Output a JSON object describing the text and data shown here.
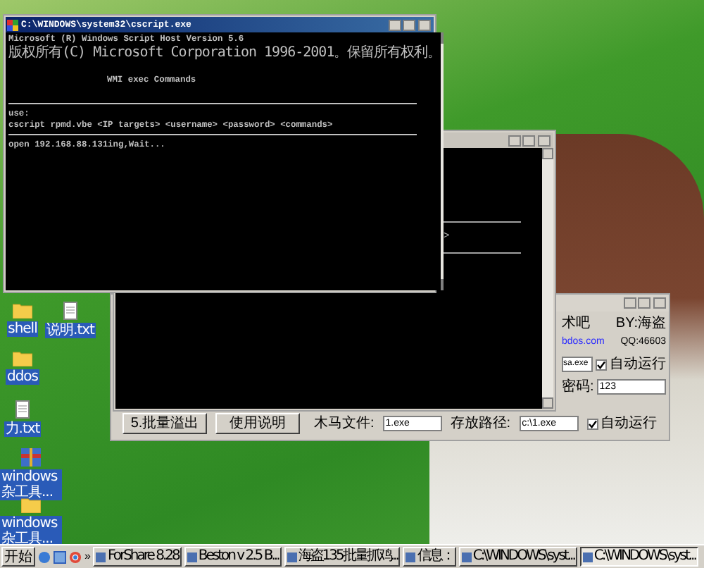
{
  "console_window": {
    "title": "C:\\WINDOWS\\system32\\cscript.exe",
    "lines": [
      {
        "kind": "text",
        "text": "Microsoft (R) Windows Script Host Version 5.6"
      },
      {
        "kind": "cjk",
        "text": "版权所有(C) Microsoft Corporation 1996-2001。保留所有权利。"
      },
      {
        "kind": "blank"
      },
      {
        "kind": "heading",
        "text": "WMI exec Commands"
      },
      {
        "kind": "blank"
      },
      {
        "kind": "rule"
      },
      {
        "kind": "text",
        "text": "use:"
      },
      {
        "kind": "text",
        "text": "cscript rpmd.vbe <IP targets> <username> <password> <commands>"
      },
      {
        "kind": "rule"
      },
      {
        "kind": "text",
        "text": "open 192.168.88.131ing,Wait..."
      }
    ]
  },
  "back_console": {
    "text": ">"
  },
  "tool_window": {
    "author": "术吧",
    "by": "BY:海盗",
    "site": "bdos.com",
    "qq": "QQ:46603",
    "exe_field": "sa.exe",
    "exe_autorun": {
      "label": "自动运行",
      "checked": true
    },
    "password_label": "密码:",
    "password": "123",
    "buttons": [
      "5.批量溢出",
      "使用说明"
    ],
    "trojan_label": "木马文件:",
    "trojan_file": "1.exe",
    "path_label": "存放路径:",
    "path": "c:\\1.exe",
    "autorun": {
      "label": "自动运行",
      "checked": true
    }
  },
  "desktop_icons": [
    {
      "label": "shell",
      "kind": "folder"
    },
    {
      "label": "说明.txt",
      "kind": "text"
    },
    {
      "label": "ddos",
      "kind": "folder"
    },
    {
      "label": "力.txt",
      "kind": "text"
    },
    {
      "label": "windows 杂工具...",
      "kind": "archive"
    },
    {
      "label": "windows 杂工具...",
      "kind": "folder"
    }
  ],
  "taskbar": {
    "start": "开始",
    "chevron": "»",
    "buttons": [
      {
        "label": "ForShare 8.28",
        "selected": false
      },
      {
        "label": "Beston v 2.5  B...",
        "selected": false
      },
      {
        "label": "海盗135批量抓鸡...",
        "selected": false
      },
      {
        "label": "信息：",
        "selected": false
      },
      {
        "label": "C:\\WINDOWS\\syst...",
        "selected": false
      },
      {
        "label": "C:\\WINDOWS\\syst...",
        "selected": true
      }
    ]
  }
}
